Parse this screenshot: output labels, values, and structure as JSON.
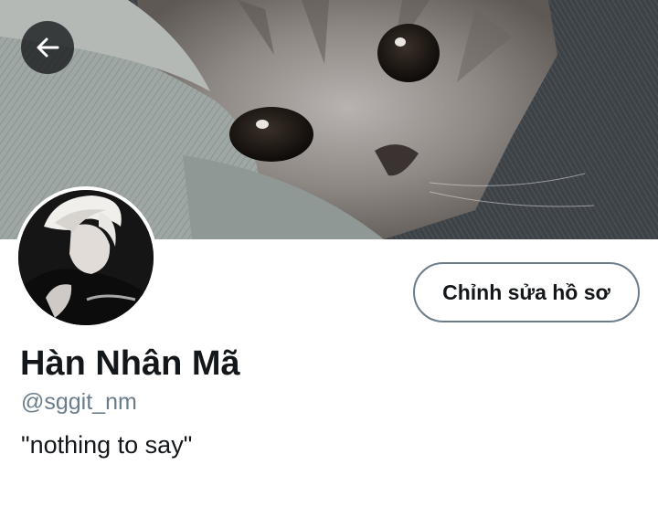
{
  "header": {
    "back_icon": "arrow-left-icon",
    "banner_image": "kitten-peeking-from-blanket-photo"
  },
  "profile": {
    "avatar_image": "person-with-blonde-hair-black-shirt-photo",
    "display_name": "Hàn Nhân Mã",
    "handle": "@sggit_nm",
    "bio": "\"nothing to say\""
  },
  "actions": {
    "edit_profile_label": "Chỉnh sửa hồ sơ"
  },
  "colors": {
    "text_primary": "#14171a",
    "text_secondary": "#6b7d8b",
    "button_border": "#6b7d8b",
    "back_button_bg": "#14171a"
  }
}
